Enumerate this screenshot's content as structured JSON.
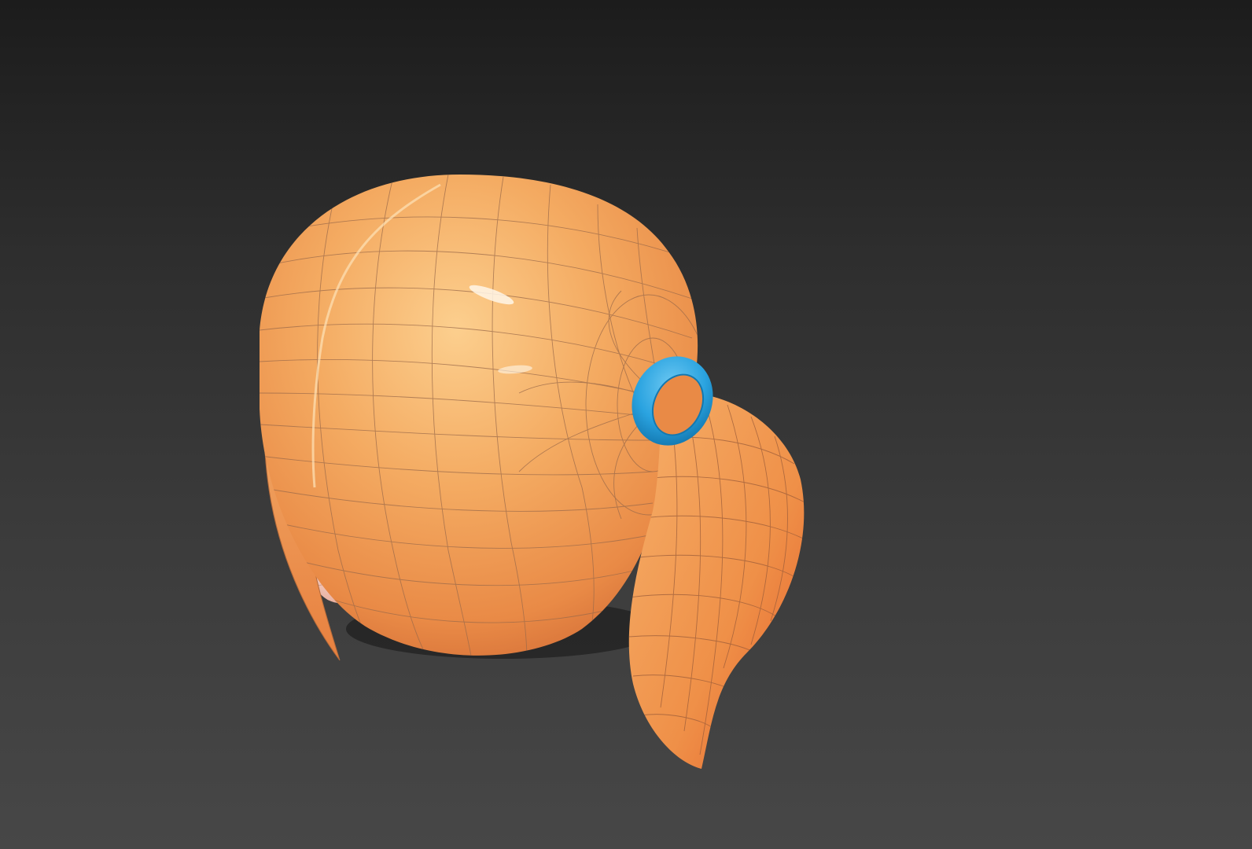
{
  "viewport": {
    "background_top": "#1c1c1c",
    "background_bottom": "#474747"
  },
  "model": {
    "subject": "hair-ponytail-mesh",
    "hair_color": "#f0a052",
    "hair_shadow_color": "#d9743a",
    "tie_color": "#2aa3e0",
    "skin_color": "#f2c1b0",
    "wireframe_color": "#8a6a58"
  }
}
